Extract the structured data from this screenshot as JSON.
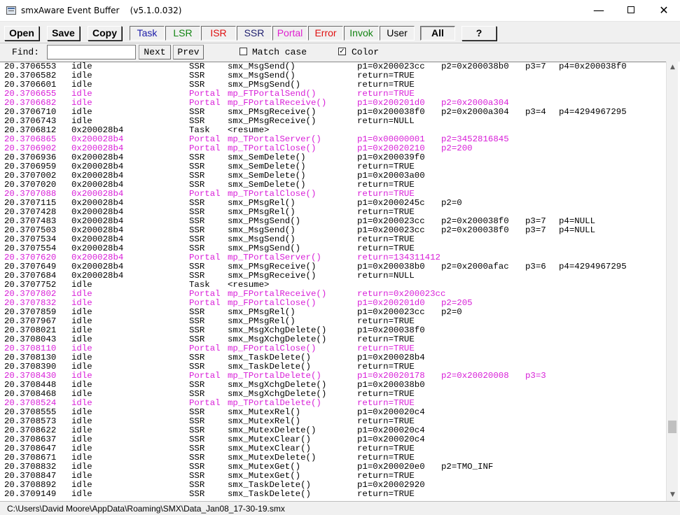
{
  "window": {
    "title": "smxAware Event Buffer    (v5.1.0.032)",
    "min_glyph": "—",
    "close_glyph": "✕"
  },
  "toolbar": {
    "open": "Open",
    "save": "Save",
    "copy": "Copy",
    "filters": [
      {
        "label": "Task",
        "color": "#1a1aa8"
      },
      {
        "label": "LSR",
        "color": "#128412"
      },
      {
        "label": "ISR",
        "color": "#e01010"
      },
      {
        "label": "SSR",
        "color": "#1e1e6e"
      },
      {
        "label": "Portal",
        "color": "#e020d0"
      },
      {
        "label": "Error",
        "color": "#e01010"
      },
      {
        "label": "Invok",
        "color": "#128412"
      },
      {
        "label": "User",
        "color": "#000000"
      }
    ],
    "all": "All",
    "help": "?"
  },
  "findbar": {
    "label": "Find:",
    "value": "",
    "next": "Next",
    "prev": "Prev",
    "match_case": "Match case",
    "match_case_checked": false,
    "color": "Color",
    "color_checked": true
  },
  "colors": {
    "normal": "#000000",
    "portal": "#d81ed8"
  },
  "rows": [
    [
      "20.3706553",
      "idle",
      "SSR",
      "smx_MsgSend()",
      "p1=0x200023cc",
      "p2=0x200038b0",
      "p3=7",
      "p4=0x200038f0",
      0
    ],
    [
      "20.3706582",
      "idle",
      "SSR",
      "smx_MsgSend()",
      "return=TRUE",
      "",
      "",
      "",
      0
    ],
    [
      "20.3706601",
      "idle",
      "SSR",
      "smx_PMsgSend()",
      "return=TRUE",
      "",
      "",
      "",
      0
    ],
    [
      "20.3706655",
      "idle",
      "Portal",
      "mp_FTPortalSend()",
      "return=TRUE",
      "",
      "",
      "",
      1
    ],
    [
      "20.3706682",
      "idle",
      "Portal",
      "mp_FPortalReceive()",
      "p1=0x200201d0",
      "p2=0x2000a304",
      "",
      "",
      1
    ],
    [
      "20.3706710",
      "idle",
      "SSR",
      "smx_PMsgReceive()",
      "p1=0x200038f0",
      "p2=0x2000a304",
      "p3=4",
      "p4=4294967295",
      0
    ],
    [
      "20.3706743",
      "idle",
      "SSR",
      "smx_PMsgReceive()",
      "return=NULL",
      "",
      "",
      "",
      0
    ],
    [
      "20.3706812",
      "0x200028b4",
      "Task",
      "<resume>",
      "",
      "",
      "",
      "",
      0
    ],
    [
      "20.3706865",
      "0x200028b4",
      "Portal",
      "mp_TPortalServer()",
      "p1=0x00000001",
      "p2=3452816845",
      "",
      "",
      1
    ],
    [
      "20.3706902",
      "0x200028b4",
      "Portal",
      "mp_TPortalClose()",
      "p1=0x20020210",
      "p2=200",
      "",
      "",
      1
    ],
    [
      "20.3706936",
      "0x200028b4",
      "SSR",
      "smx_SemDelete()",
      "p1=0x200039f0",
      "",
      "",
      "",
      0
    ],
    [
      "20.3706959",
      "0x200028b4",
      "SSR",
      "smx_SemDelete()",
      "return=TRUE",
      "",
      "",
      "",
      0
    ],
    [
      "20.3707002",
      "0x200028b4",
      "SSR",
      "smx_SemDelete()",
      "p1=0x20003a00",
      "",
      "",
      "",
      0
    ],
    [
      "20.3707020",
      "0x200028b4",
      "SSR",
      "smx_SemDelete()",
      "return=TRUE",
      "",
      "",
      "",
      0
    ],
    [
      "20.3707088",
      "0x200028b4",
      "Portal",
      "mp_TPortalClose()",
      "return=TRUE",
      "",
      "",
      "",
      1
    ],
    [
      "20.3707115",
      "0x200028b4",
      "SSR",
      "smx_PMsgRel()",
      "p1=0x2000245c",
      "p2=0",
      "",
      "",
      0
    ],
    [
      "20.3707428",
      "0x200028b4",
      "SSR",
      "smx_PMsgRel()",
      "return=TRUE",
      "",
      "",
      "",
      0
    ],
    [
      "20.3707483",
      "0x200028b4",
      "SSR",
      "smx_PMsgSend()",
      "p1=0x200023cc",
      "p2=0x200038f0",
      "p3=7",
      "p4=NULL",
      0
    ],
    [
      "20.3707503",
      "0x200028b4",
      "SSR",
      "smx_MsgSend()",
      "p1=0x200023cc",
      "p2=0x200038f0",
      "p3=7",
      "p4=NULL",
      0
    ],
    [
      "20.3707534",
      "0x200028b4",
      "SSR",
      "smx_MsgSend()",
      "return=TRUE",
      "",
      "",
      "",
      0
    ],
    [
      "20.3707554",
      "0x200028b4",
      "SSR",
      "smx_PMsgSend()",
      "return=TRUE",
      "",
      "",
      "",
      0
    ],
    [
      "20.3707620",
      "0x200028b4",
      "Portal",
      "mp_TPortalServer()",
      "return=134311412",
      "",
      "",
      "",
      1
    ],
    [
      "20.3707649",
      "0x200028b4",
      "SSR",
      "smx_PMsgReceive()",
      "p1=0x200038b0",
      "p2=0x2000afac",
      "p3=6",
      "p4=4294967295",
      0
    ],
    [
      "20.3707684",
      "0x200028b4",
      "SSR",
      "smx_PMsgReceive()",
      "return=NULL",
      "",
      "",
      "",
      0
    ],
    [
      "20.3707752",
      "idle",
      "Task",
      "<resume>",
      "",
      "",
      "",
      "",
      0
    ],
    [
      "20.3707802",
      "idle",
      "Portal",
      "mp_FPortalReceive()",
      "return=0x200023cc",
      "",
      "",
      "",
      1
    ],
    [
      "20.3707832",
      "idle",
      "Portal",
      "mp_FPortalClose()",
      "p1=0x200201d0",
      "p2=205",
      "",
      "",
      1
    ],
    [
      "20.3707859",
      "idle",
      "SSR",
      "smx_PMsgRel()",
      "p1=0x200023cc",
      "p2=0",
      "",
      "",
      0
    ],
    [
      "20.3707967",
      "idle",
      "SSR",
      "smx_PMsgRel()",
      "return=TRUE",
      "",
      "",
      "",
      0
    ],
    [
      "20.3708021",
      "idle",
      "SSR",
      "smx_MsgXchgDelete()",
      "p1=0x200038f0",
      "",
      "",
      "",
      0
    ],
    [
      "20.3708043",
      "idle",
      "SSR",
      "smx_MsgXchgDelete()",
      "return=TRUE",
      "",
      "",
      "",
      0
    ],
    [
      "20.3708110",
      "idle",
      "Portal",
      "mp_FPortalClose()",
      "return=TRUE",
      "",
      "",
      "",
      1
    ],
    [
      "20.3708130",
      "idle",
      "SSR",
      "smx_TaskDelete()",
      "p1=0x200028b4",
      "",
      "",
      "",
      0
    ],
    [
      "20.3708390",
      "idle",
      "SSR",
      "smx_TaskDelete()",
      "return=TRUE",
      "",
      "",
      "",
      0
    ],
    [
      "20.3708430",
      "idle",
      "Portal",
      "mp_TPortalDelete()",
      "p1=0x20020178",
      "p2=0x20020008",
      "p3=3",
      "",
      1
    ],
    [
      "20.3708448",
      "idle",
      "SSR",
      "smx_MsgXchgDelete()",
      "p1=0x200038b0",
      "",
      "",
      "",
      0
    ],
    [
      "20.3708468",
      "idle",
      "SSR",
      "smx_MsgXchgDelete()",
      "return=TRUE",
      "",
      "",
      "",
      0
    ],
    [
      "20.3708524",
      "idle",
      "Portal",
      "mp_TPortalDelete()",
      "return=TRUE",
      "",
      "",
      "",
      1
    ],
    [
      "20.3708555",
      "idle",
      "SSR",
      "smx_MutexRel()",
      "p1=0x200020c4",
      "",
      "",
      "",
      0
    ],
    [
      "20.3708573",
      "idle",
      "SSR",
      "smx_MutexRel()",
      "return=TRUE",
      "",
      "",
      "",
      0
    ],
    [
      "20.3708622",
      "idle",
      "SSR",
      "smx_MutexDelete()",
      "p1=0x200020c4",
      "",
      "",
      "",
      0
    ],
    [
      "20.3708637",
      "idle",
      "SSR",
      "smx_MutexClear()",
      "p1=0x200020c4",
      "",
      "",
      "",
      0
    ],
    [
      "20.3708647",
      "idle",
      "SSR",
      "smx_MutexClear()",
      "return=TRUE",
      "",
      "",
      "",
      0
    ],
    [
      "20.3708671",
      "idle",
      "SSR",
      "smx_MutexDelete()",
      "return=TRUE",
      "",
      "",
      "",
      0
    ],
    [
      "20.3708832",
      "idle",
      "SSR",
      "smx_MutexGet()",
      "p1=0x200020e0",
      "p2=TMO_INF",
      "",
      "",
      0
    ],
    [
      "20.3708847",
      "idle",
      "SSR",
      "smx_MutexGet()",
      "return=TRUE",
      "",
      "",
      "",
      0
    ],
    [
      "20.3708892",
      "idle",
      "SSR",
      "smx_TaskDelete()",
      "p1=0x20002920",
      "",
      "",
      "",
      0
    ],
    [
      "20.3709149",
      "idle",
      "SSR",
      "smx_TaskDelete()",
      "return=TRUE",
      "",
      "",
      "",
      0
    ]
  ],
  "scrollbar": {
    "up": "▲",
    "down": "▼"
  },
  "status": {
    "path": "C:\\Users\\David Moore\\AppData\\Roaming\\SMX\\Data_Jan08_17-30-19.smx"
  }
}
